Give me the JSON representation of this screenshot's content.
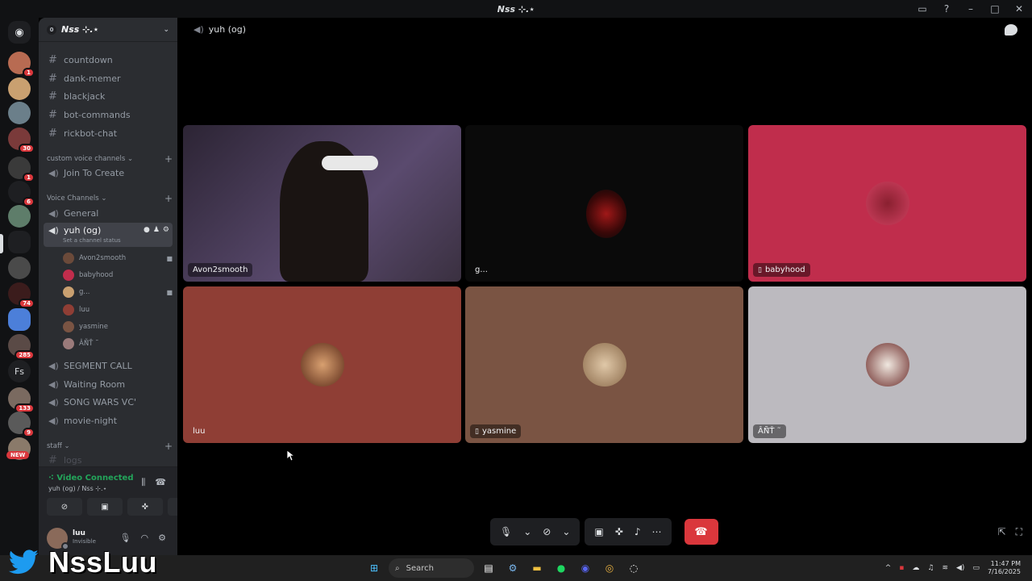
{
  "window": {
    "title": "Nss ⊹.⋆"
  },
  "rail": {
    "badges": [
      "1",
      "30",
      "1",
      "6",
      "74",
      "285",
      "133",
      "9"
    ],
    "text_icon": "Fs",
    "new_label": "NEW"
  },
  "guild": {
    "name": "Nss ⊹.⋆",
    "icon": "0",
    "text_channels": [
      "countdown",
      "dank-memer",
      "blackjack",
      "bot-commands",
      "rickbot-chat"
    ],
    "categories": {
      "custom": "custom voice channels",
      "voice": "Voice Channels",
      "staff": "staff"
    },
    "join_to_create": "Join To Create",
    "general": "General",
    "active_channel": "yuh (og)",
    "active_status": "Set a channel status",
    "members": [
      "Avon2smooth",
      "babyhood",
      "g...",
      "luu",
      "yasmine",
      "ÂÑ̃Ť ˜"
    ],
    "more_voice": [
      "SEGMENT CALL",
      "Waiting Room",
      "SONG WARS VC'",
      "movie-night"
    ],
    "staff_channel": "logs"
  },
  "voice_panel": {
    "status": "Video Connected",
    "location": "yuh (og) / Nss ⊹.⋆"
  },
  "user": {
    "name": "luu",
    "status": "Invisible"
  },
  "main": {
    "channel": "yuh (og)",
    "tiles": [
      {
        "name": "Avon2smooth",
        "bg": "#3a2d44",
        "mobile": false
      },
      {
        "name": "g...",
        "bg": "#0b0b0b",
        "mobile": false
      },
      {
        "name": "babyhood",
        "bg": "#c02d4c",
        "mobile": true
      },
      {
        "name": "luu",
        "bg": "#8f3e35",
        "mobile": false
      },
      {
        "name": "yasmine",
        "bg": "#7a5443",
        "mobile": true
      },
      {
        "name": "ÂÑ̃Ť ˜",
        "bg": "#bcbabf",
        "mobile": false
      }
    ]
  },
  "taskbar": {
    "search": "Search",
    "time": "11:47 PM",
    "date": "7/16/2025"
  },
  "watermark": {
    "text": "NssLuu"
  },
  "colors": {
    "accent_green": "#23a55a",
    "end_call_red": "#da373c",
    "badge_red": "#da373c"
  }
}
